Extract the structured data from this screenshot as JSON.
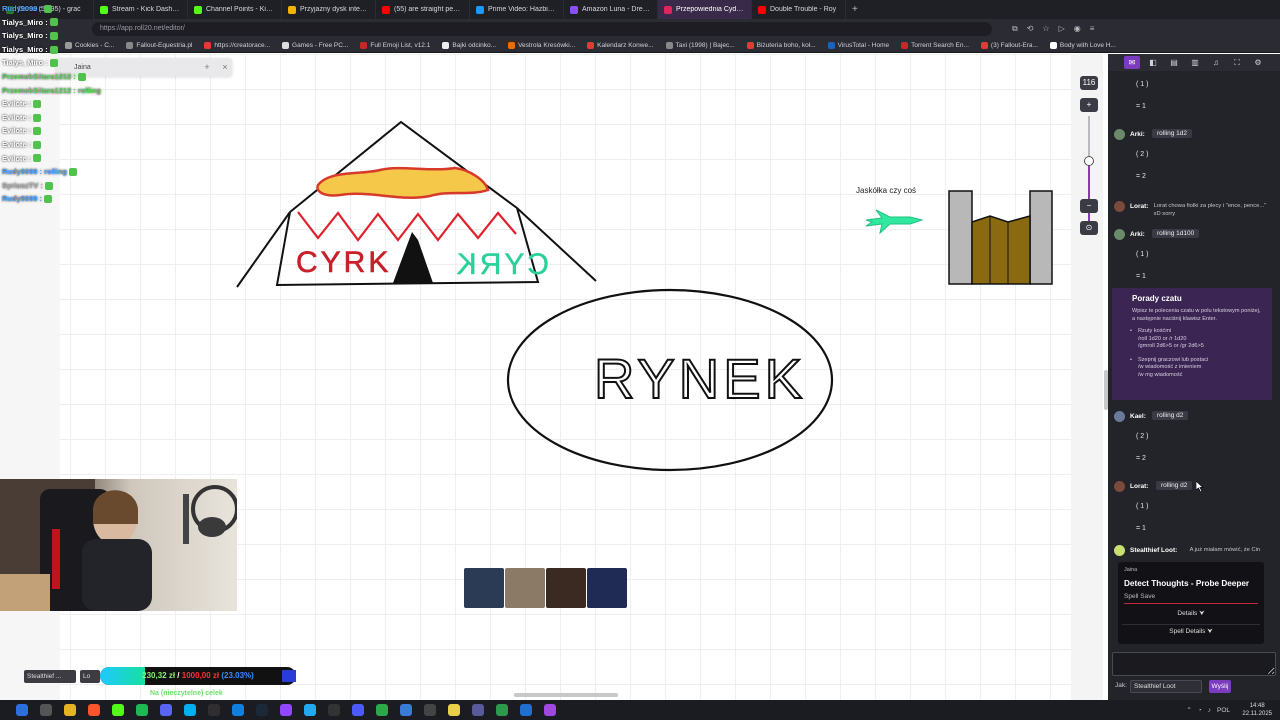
{
  "browser": {
    "tabs": [
      {
        "label": "Dama (5 095) - grać",
        "color": "#2e7d32"
      },
      {
        "label": "Stream - Kick Dashboard",
        "color": "#53fc18"
      },
      {
        "label": "Channel Points - Kick Da",
        "color": "#53fc18"
      },
      {
        "label": "Przyjazny dysk internetow",
        "color": "#f4b400"
      },
      {
        "label": "(55) are straight people o",
        "color": "#ff0000"
      },
      {
        "label": "Prime Video: Hazbin Hote",
        "color": "#1a98ff"
      },
      {
        "label": "Amazon Luna - Dream Ta",
        "color": "#8a4dff"
      },
      {
        "label": "Przepowiednia Cydru | R",
        "color": "#e0245e",
        "active": true
      },
      {
        "label": "Double Trouble - Roy",
        "color": "#ff0000"
      }
    ],
    "new_tab": "+",
    "url": "https://app.roll20.net/editor/",
    "bookmarks": [
      {
        "label": "Cookies - C...",
        "color": "#999"
      },
      {
        "label": "Fallout-Equestria.pl",
        "color": "#888"
      },
      {
        "label": "https://creatorace...",
        "color": "#e53935"
      },
      {
        "label": "Games - Free PC...",
        "color": "#ddd"
      },
      {
        "label": "Full Emoji List, v12.1",
        "color": "#c62828"
      },
      {
        "label": "Bajki odcinko...",
        "color": "#eee"
      },
      {
        "label": "Vestrola Kresówki...",
        "color": "#ef6c00"
      },
      {
        "label": "Kalendarz Konwe...",
        "color": "#e53935"
      },
      {
        "label": "Taxi (1998) | Bajec...",
        "color": "#888"
      },
      {
        "label": "Biżuteria boho, koł...",
        "color": "#e53935"
      },
      {
        "label": "VirusTotal - Home",
        "color": "#1565c0"
      },
      {
        "label": "Torrent Search En...",
        "color": "#c62828"
      },
      {
        "label": "(3) Fallout-Era...",
        "color": "#e53935"
      },
      {
        "label": "Body with Love H...",
        "color": "#fff"
      }
    ]
  },
  "overlay_chat": {
    "lines": [
      {
        "name": "Rudy9099 :",
        "color": "#4fa3ff"
      },
      {
        "name": "Tialys_Miro :",
        "color": "#ffffff"
      },
      {
        "name": "Tialys_Miro :",
        "color": "#ffffff"
      },
      {
        "name": "Tialys_Miro :",
        "color": "#ffffff"
      },
      {
        "name": "Tialys_Miro :",
        "color": "#ffffff"
      },
      {
        "name": "PrzemekGitara1212 :",
        "color": "#5fd35f"
      },
      {
        "name": "PrzemekGitara1212 : rolling",
        "color": "#5fd35f"
      },
      {
        "name": "Evilote :",
        "color": "#ffffff"
      },
      {
        "name": "Evilote :",
        "color": "#ffffff"
      },
      {
        "name": "Evilote :",
        "color": "#ffffff"
      },
      {
        "name": "Evilote :",
        "color": "#ffffff"
      },
      {
        "name": "Evilote :",
        "color": "#ffffff"
      },
      {
        "name": "Rudy9099 : rolling",
        "color": "#4fa3ff"
      },
      {
        "name": "SyriuszTV :",
        "color": "#b0b0b0"
      },
      {
        "name": "Rudy9099 :",
        "color": "#4fa3ff"
      }
    ]
  },
  "floating_panel": {
    "name": "Jaina",
    "add": "+",
    "close": "×"
  },
  "canvas": {
    "cyrk_left": "CYRK",
    "cyrk_right": "CYRK",
    "rynek": "RYNEK",
    "swallow_caption": "Jaskółka czy coś"
  },
  "zoom": {
    "level": "116",
    "plus": "+",
    "minus": "−",
    "reset": "⊙"
  },
  "tokens": [
    {
      "name": "token-1",
      "color": "#2b3a55"
    },
    {
      "name": "token-2",
      "color": "#8a7a66"
    },
    {
      "name": "token-3",
      "color": "#3a2a22"
    },
    {
      "name": "token-4",
      "color": "#1f2a55"
    }
  ],
  "goal": {
    "current": "230,32 zł",
    "separator": "/",
    "target": "1000,00 zł",
    "percent": "(23.03%)",
    "fraction": 0.2303,
    "subtitle": "Na (nieczytelne) celek",
    "tag1": "Stealthief ...",
    "tag2": "Lo"
  },
  "roll20_chat": {
    "toolbar": [
      {
        "icon": "chat-icon",
        "glyph": "✉",
        "active": true
      },
      {
        "icon": "art-library-icon",
        "glyph": "◧"
      },
      {
        "icon": "journal-icon",
        "glyph": "▤"
      },
      {
        "icon": "compendium-icon",
        "glyph": "▥"
      },
      {
        "icon": "jukebox-icon",
        "glyph": "♫"
      },
      {
        "icon": "collections-icon",
        "glyph": "⛶"
      },
      {
        "icon": "settings-icon",
        "glyph": "⚙"
      }
    ],
    "messages": [
      {
        "type": "result",
        "res": "( 1 )",
        "tot": "= 1"
      },
      {
        "type": "roll",
        "who": "Arki:",
        "roll": "rolling 1d2",
        "res": "( 2 )",
        "tot": "= 2",
        "avatar": "#6a8a6a"
      },
      {
        "type": "text",
        "who": "Lorat:",
        "text": "Lorat chowa fiolki za plecy i \"ence, pence...\" xD sorry",
        "avatar": "#7a4a3a"
      },
      {
        "type": "roll",
        "who": "Arki:",
        "roll": "rolling 1d100",
        "res": "( 1 )",
        "tot": "= 1",
        "avatar": "#6a8a6a"
      },
      {
        "type": "roll",
        "who": "Kael:",
        "roll": "rolling d2",
        "res": "( 2 )",
        "tot": "= 2",
        "avatar": "#6a7a9a"
      },
      {
        "type": "roll",
        "who": "Lorat:",
        "roll": "rolling d2",
        "res": "( 1 )",
        "tot": "= 1",
        "avatar": "#7a4a3a"
      },
      {
        "type": "text",
        "who": "Stealthief Loot:",
        "text": "A już miałam mówić, że Cin",
        "avatar": "#c8e070"
      }
    ],
    "tips": {
      "title": "Porady czatu",
      "intro": "Wpisz te polecenia czatu w polu tekstowym poniżej, a następnie naciśnij klawisz Enter.",
      "item1_title": "Rzuty kośćmi",
      "item1_lines": [
        "/roll 1d20 or /r 1d20",
        "/gmroll 2d6>5 or /gr 2d6>5"
      ],
      "item2_title": "Szepnij graczowi lub postaci",
      "item2_lines": [
        "/w wiadomość z imieniem",
        "/w mg wiadomość"
      ]
    },
    "spell_card": {
      "owner": "Jaina",
      "title": "Detect Thoughts - Probe Deeper",
      "subtitle": "Spell Save",
      "details": "Details ⮟",
      "spell_details": "Spell Details ⮟"
    },
    "as_label": "Jak:",
    "as_value": "Stealthief Loot",
    "send": "Wyślij"
  },
  "taskbar": {
    "icons": [
      {
        "name": "start-icon",
        "color": "#2e6fe0"
      },
      {
        "name": "search-icon",
        "color": "#555"
      },
      {
        "name": "explorer-icon",
        "color": "#e6b422"
      },
      {
        "name": "brave-icon",
        "color": "#fb542b"
      },
      {
        "name": "kick-icon",
        "color": "#53fc18"
      },
      {
        "name": "spotify-icon",
        "color": "#1db954"
      },
      {
        "name": "discord-icon",
        "color": "#5865f2"
      },
      {
        "name": "skype-icon",
        "color": "#00aff0"
      },
      {
        "name": "obs-icon",
        "color": "#302e31"
      },
      {
        "name": "edge-icon",
        "color": "#0f7fe0"
      },
      {
        "name": "steam-icon",
        "color": "#1b2838"
      },
      {
        "name": "twitch-icon",
        "color": "#9146ff"
      },
      {
        "name": "vscode-icon",
        "color": "#23a9f2"
      },
      {
        "name": "epic-icon",
        "color": "#333"
      },
      {
        "name": "app-icon",
        "color": "#4a5aff"
      },
      {
        "name": "app2-icon",
        "color": "#2aa84a"
      },
      {
        "name": "app3-icon",
        "color": "#3a7bd5"
      },
      {
        "name": "app4-icon",
        "color": "#444"
      },
      {
        "name": "app5-icon",
        "color": "#e8d04a"
      },
      {
        "name": "app6-icon",
        "color": "#5a5a9a"
      },
      {
        "name": "app7-icon",
        "color": "#2b9a4a"
      },
      {
        "name": "app8-icon",
        "color": "#1f6fd0"
      },
      {
        "name": "app9-icon",
        "color": "#a048e0"
      }
    ],
    "lang": "POL",
    "time": "14:48",
    "date": "22.11.2025"
  }
}
